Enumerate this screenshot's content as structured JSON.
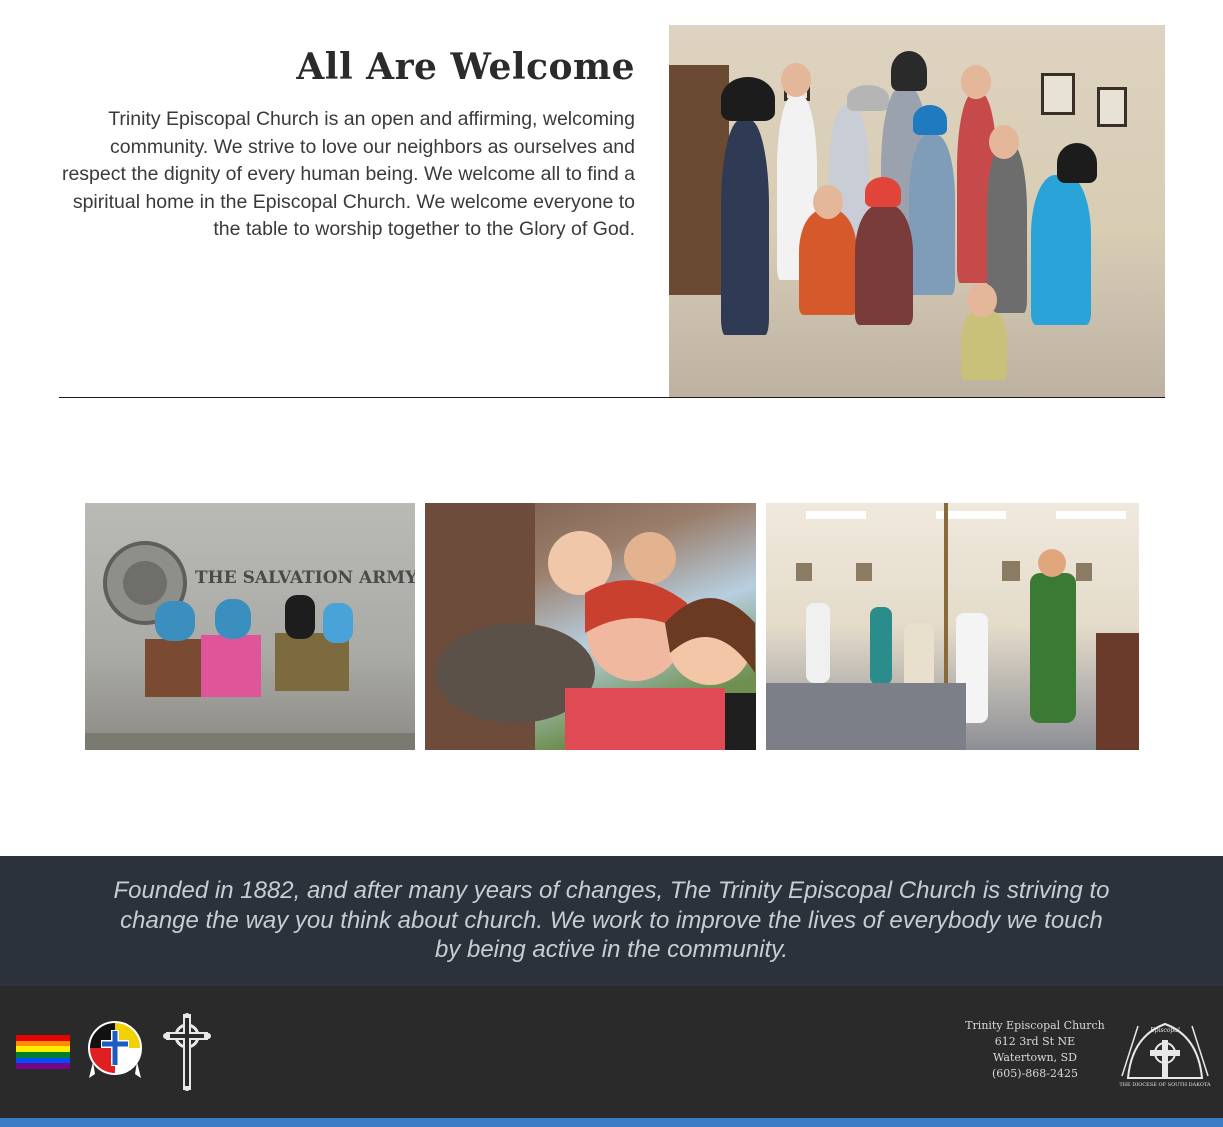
{
  "welcome": {
    "title": "All Are Welcome",
    "body": "Trinity Episcopal Church is an open and affirming, welcoming community. We strive to love our neighbors as ourselves and respect the dignity of every human being. We welcome all to find a spiritual home in the Episcopal Church. We welcome everyone to the table to worship together to the Glory of God."
  },
  "gallery": {
    "salvation_sign": "THE SALVATION ARMY"
  },
  "mission": {
    "text": "Founded in 1882, and after many years of changes, The Trinity Episcopal Church is striving to change the way you think about church. We work to improve the lives of everybody we touch by being active in the community."
  },
  "footer": {
    "address": {
      "name": "Trinity Episcopal Church",
      "street": "612 3rd St NE",
      "city": "Watertown, SD",
      "phone": "(605)-868-2425"
    },
    "diocese_logo_text": "THE DIOCESE OF SOUTH DAKOTA",
    "icons": [
      "pride-flag-icon",
      "medicine-wheel-icon",
      "celtic-cross-icon",
      "diocese-logo-icon"
    ],
    "pride_colors": [
      "#e40303",
      "#ff8c00",
      "#ffed00",
      "#008026",
      "#004dff",
      "#750787"
    ]
  },
  "colors": {
    "mission_bg": "#2b323b",
    "footer_bg": "#2a2a2a",
    "accent": "#3b7cc4"
  }
}
